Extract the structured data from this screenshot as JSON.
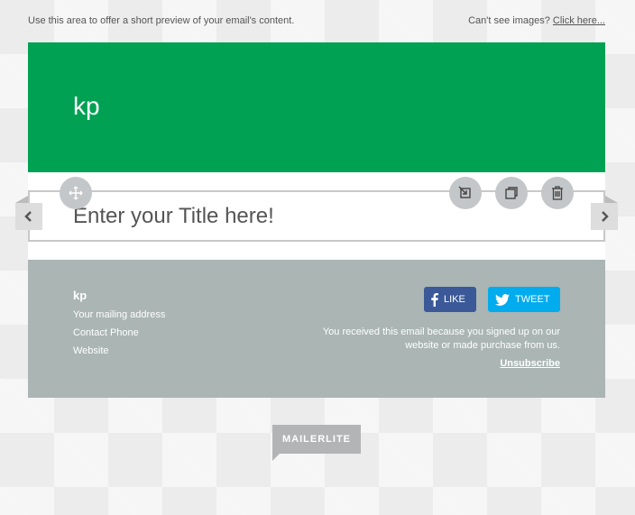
{
  "preheader": {
    "preview_text": "Use this area to offer a short preview of your email's content.",
    "cant_see_text": "Can't see images?",
    "click_here": "Click here..."
  },
  "header": {
    "brand": "kp",
    "color": "#00a153"
  },
  "content": {
    "title": "Enter your Title here!"
  },
  "tools": {
    "move_icon": "move-icon",
    "resize_icon": "resize-icon",
    "duplicate_icon": "duplicate-icon",
    "delete_icon": "trash-icon",
    "prev_icon": "chevron-left-icon",
    "next_icon": "chevron-right-icon"
  },
  "footer": {
    "name": "kp",
    "address": "Your mailing address",
    "phone": "Contact Phone",
    "website": "Website",
    "like_label": "LIKE",
    "tweet_label": "TWEET",
    "notice": "You received this email because you signed up on our website or made purchase from us.",
    "unsubscribe": "Unsubscribe",
    "color": "#aab5b4"
  },
  "badge": {
    "label": "MAILERLITE"
  }
}
